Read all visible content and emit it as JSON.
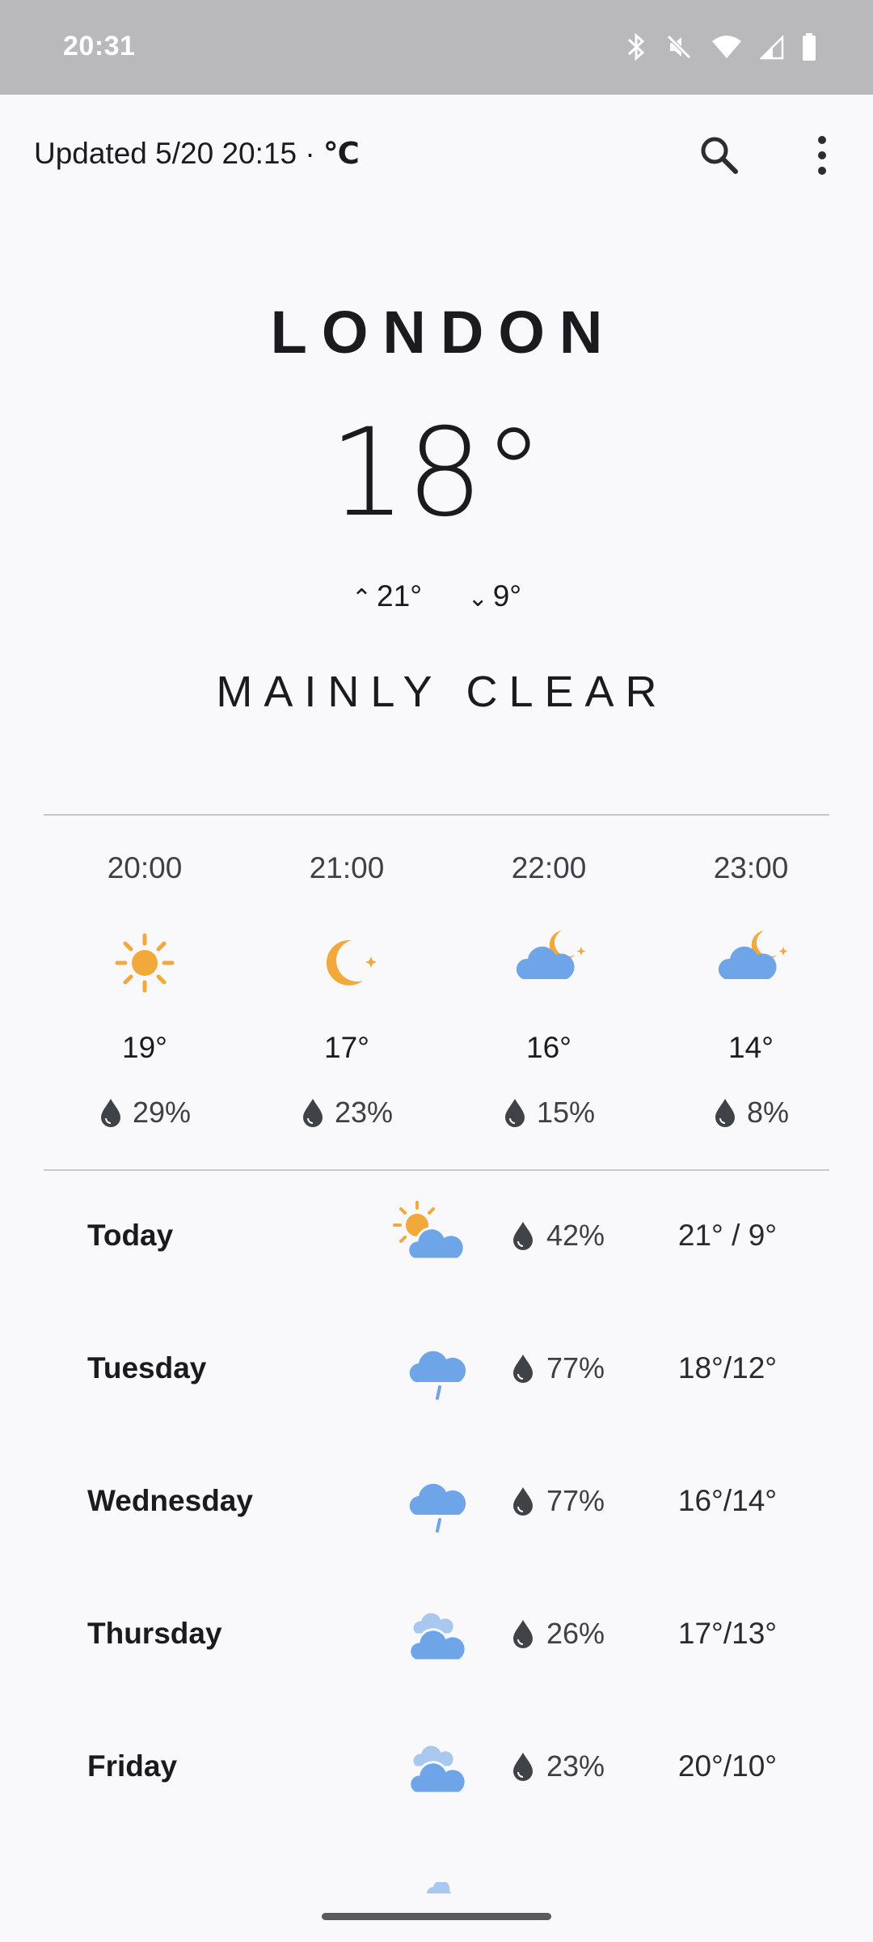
{
  "status_bar": {
    "time": "20:31",
    "icons": [
      "bluetooth-icon",
      "mute-icon",
      "wifi-icon",
      "signal-icon",
      "battery-icon"
    ]
  },
  "header": {
    "updated_text": "Updated 5/20 20:15 · ",
    "unit": "℃",
    "actions": [
      "search-icon",
      "more-vert-icon"
    ]
  },
  "current": {
    "city": "LONDON",
    "temperature": "18°",
    "high": "21°",
    "low": "9°",
    "condition": "MAINLY CLEAR"
  },
  "hourly": [
    {
      "time": "20:00",
      "icon": "sun-icon",
      "temp": "19°",
      "rain": "29%"
    },
    {
      "time": "21:00",
      "icon": "moon-icon",
      "temp": "17°",
      "rain": "23%"
    },
    {
      "time": "22:00",
      "icon": "cloud-moon-icon",
      "temp": "16°",
      "rain": "15%"
    },
    {
      "time": "23:00",
      "icon": "cloud-moon-icon",
      "temp": "14°",
      "rain": "8%"
    }
  ],
  "daily": [
    {
      "day": "Today",
      "icon": "sun-cloud-icon",
      "rain": "42%",
      "range": "21° / 9°"
    },
    {
      "day": "Tuesday",
      "icon": "cloud-drizzle-icon",
      "rain": "77%",
      "range": "18°/12°"
    },
    {
      "day": "Wednesday",
      "icon": "cloud-drizzle-icon",
      "rain": "77%",
      "range": "16°/14°"
    },
    {
      "day": "Thursday",
      "icon": "clouds-icon",
      "rain": "26%",
      "range": "17°/13°"
    },
    {
      "day": "Friday",
      "icon": "clouds-icon",
      "rain": "23%",
      "range": "20°/10°"
    }
  ],
  "colors": {
    "background": "#f9f9fc",
    "status_bar": "#b9b9bb",
    "sun": "#f2a93b",
    "cloud": "#6ea5e8",
    "drop": "#3f4348"
  }
}
